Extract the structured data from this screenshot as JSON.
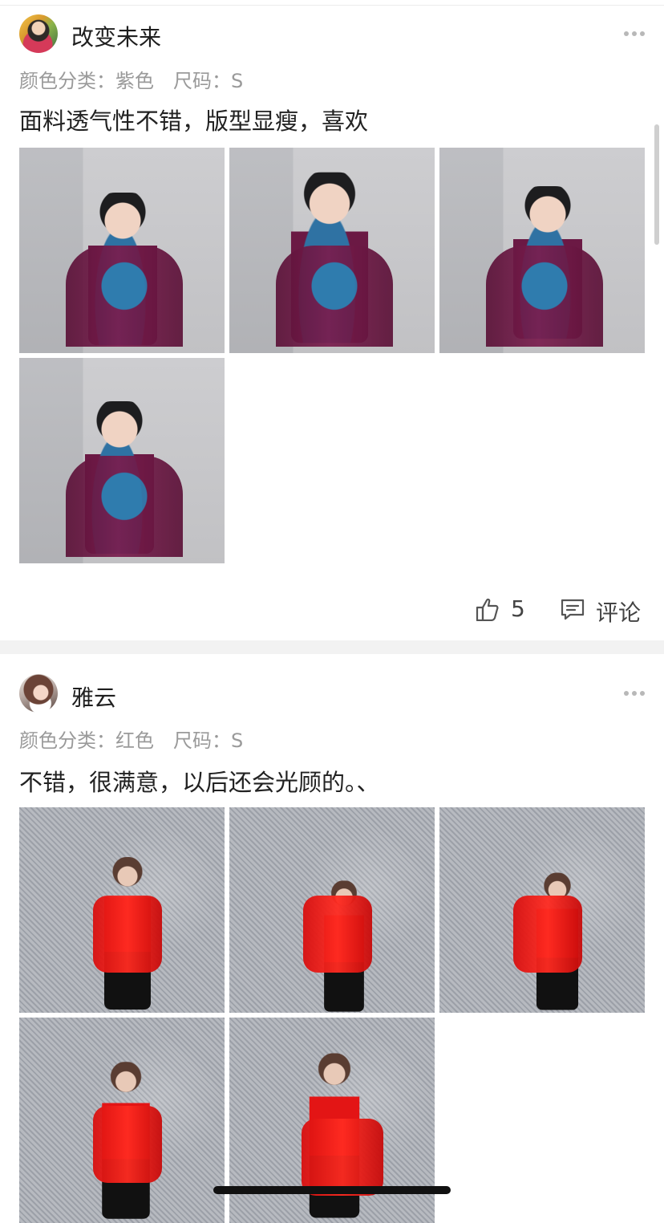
{
  "reviews": [
    {
      "username": "改变未来",
      "color_label": "颜色分类：",
      "color_value": "紫色",
      "size_label": "尺码：",
      "size_value": "S",
      "text": "面料透气性不错，版型显瘦，喜欢",
      "likes": "5",
      "comment_label": "评论",
      "photos": 4
    },
    {
      "username": "雅云",
      "color_label": "颜色分类：",
      "color_value": "红色",
      "size_label": "尺码：",
      "size_value": "S",
      "text": "不错，很满意，以后还会光顾的。、",
      "photos": 5
    }
  ],
  "icons": {
    "more": "more-icon",
    "like": "thumbs-up-icon",
    "comment": "comment-icon"
  }
}
